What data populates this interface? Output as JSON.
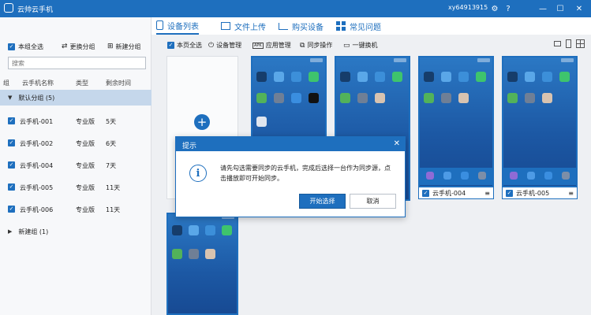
{
  "window": {
    "title": "云帅云手机",
    "user": "xy64913915",
    "icons": [
      "settings-icon",
      "minimize-icon",
      "maximize-icon",
      "close-icon"
    ]
  },
  "nav": {
    "tabs": [
      {
        "label": "设备列表",
        "icon": "phone-icon",
        "active": true
      },
      {
        "label": "文件上传",
        "icon": "folder-icon",
        "active": false
      },
      {
        "label": "购买设备",
        "icon": "cart-icon",
        "active": false
      },
      {
        "label": "常见问题",
        "icon": "grid-icon",
        "active": false
      }
    ]
  },
  "sidebar": {
    "select_all": "本组全选",
    "change_group": "更换分组",
    "new_group": "新建分组",
    "search_placeholder": "搜索",
    "columns": [
      "组",
      "云手机名称",
      "类型",
      "剩余时间"
    ],
    "default_group": "默认分组 (5)",
    "devices": [
      {
        "name": "云手机-001",
        "type": "专业版",
        "time": "5天"
      },
      {
        "name": "云手机-002",
        "type": "专业版",
        "time": "6天"
      },
      {
        "name": "云手机-004",
        "type": "专业版",
        "time": "7天"
      },
      {
        "name": "云手机-005",
        "type": "专业版",
        "time": "11天"
      },
      {
        "name": "云手机-006",
        "type": "专业版",
        "time": "11天"
      }
    ],
    "new_group_item": "新建组 (1)"
  },
  "toolbar": {
    "select_page": "本页全选",
    "device_mgmt": "设备管理",
    "app_mgmt": "应用管理",
    "sync_op": "同步操作",
    "one_key": "一键换机"
  },
  "phones": [
    {
      "caption": "云手机-004"
    },
    {
      "caption": "云手机-005"
    }
  ],
  "dialog": {
    "title": "提示",
    "message": "请先勾选需要同步的云手机，完成后选择一台作为同步源，点击播放即可开始同步。",
    "confirm": "开始选择",
    "cancel": "取消"
  },
  "colors": {
    "accent": "#1e6fbe",
    "selected_row": "#c5d7eb"
  }
}
